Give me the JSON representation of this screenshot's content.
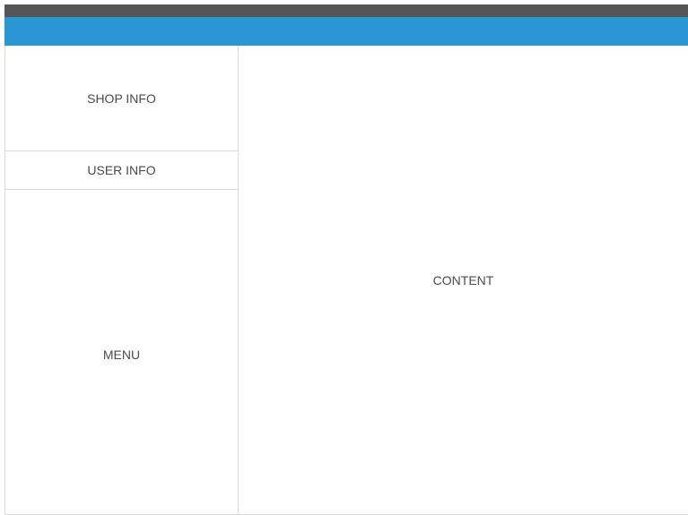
{
  "layout": {
    "shop_info_label": "SHOP INFO",
    "user_info_label": "USER INFO",
    "menu_label": "MENU",
    "content_label": "CONTENT"
  },
  "colors": {
    "top_bar": "#555555",
    "header_bar": "#2a96d3",
    "border": "#d9d9d9",
    "text": "#4a4a4a",
    "background": "#ffffff"
  }
}
